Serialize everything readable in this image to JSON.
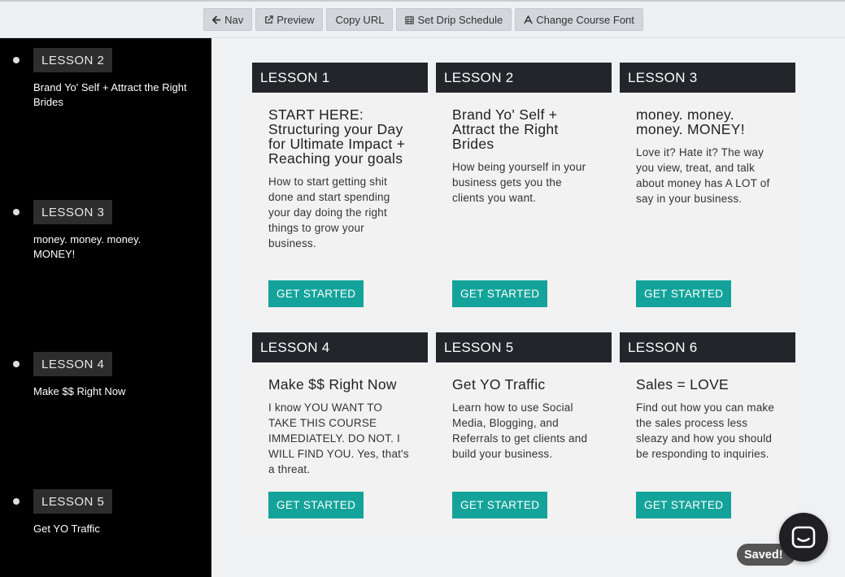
{
  "toolbar": {
    "nav": "Nav",
    "preview": "Preview",
    "copy_url": "Copy URL",
    "drip": "Set Drip Schedule",
    "font": "Change Course Font"
  },
  "sidebar": {
    "items": [
      {
        "badge": "LESSON 2",
        "title": "Brand Yo' Self + Attract the Right Brides"
      },
      {
        "badge": "LESSON 3",
        "title": "money. money. money. MONEY!"
      },
      {
        "badge": "LESSON 4",
        "title": "Make $$ Right Now"
      },
      {
        "badge": "LESSON 5",
        "title": "Get YO Traffic"
      }
    ]
  },
  "lessons": [
    {
      "label": "LESSON 1",
      "title": "START HERE: Structuring your Day for Ultimate Impact + Reaching your goals",
      "desc": "How to start getting shit done and start spending your day doing the right things to grow your business.",
      "button": "GET STARTED"
    },
    {
      "label": "LESSON 2",
      "title": "Brand Yo' Self + Attract the Right Brides",
      "desc": "How being yourself in your business gets you the clients you want.",
      "button": "GET STARTED"
    },
    {
      "label": "LESSON 3",
      "title": "money. money. money. MONEY!",
      "desc": "Love it? Hate it? The way you view, treat, and talk about money has A LOT of say in your business.",
      "button": "GET STARTED"
    },
    {
      "label": "LESSON 4",
      "title": "Make $$ Right Now",
      "desc": "I know YOU WANT TO TAKE THIS COURSE IMMEDIATELY. DO NOT. I WILL FIND YOU. Yes, that's a threat.",
      "button": "GET STARTED"
    },
    {
      "label": "LESSON 5",
      "title": "Get YO Traffic",
      "desc": "Learn how to use Social Media, Blogging, and Referrals to get clients and build your business.",
      "button": "GET STARTED"
    },
    {
      "label": "LESSON 6",
      "title": "Sales = LOVE",
      "desc": "Find out how you can make the sales process less sleazy and how you should be responding to inquiries.",
      "button": "GET STARTED"
    }
  ],
  "status": {
    "saved": "Saved!"
  },
  "colors": {
    "accent": "#14a39a",
    "card_header": "#24252b",
    "sidebar": "#000000"
  },
  "icons": {
    "nav": "arrow-left-icon",
    "preview": "external-link-icon",
    "drip": "calendar-icon",
    "font": "font-icon",
    "chat": "chat-bubble-icon"
  }
}
